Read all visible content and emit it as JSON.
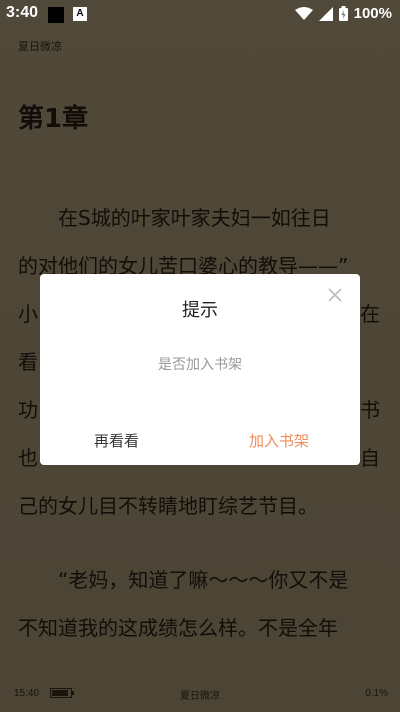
{
  "statusbar": {
    "time": "3:40",
    "notif_icon": "A",
    "battery": "100%"
  },
  "book_title": "夏日微凉",
  "chapter_title": "第1章",
  "paragraph_lines": [
    "　　在S城的叶家叶家夫妇一如往日",
    "的对他们的女儿苦口婆心的教导——”",
    "小",
    "看",
    "功",
    "也",
    "己的女儿目不转睛地盯综艺节目。",
    "　　“老妈，知道了嘛～～～你又不是",
    "不知道我的这成绩怎么样。不是全年"
  ],
  "peek_right": [
    "在",
    "书",
    "自"
  ],
  "footer": {
    "time": "15:40",
    "book": "夏日微凉",
    "progress": "0.1%"
  },
  "dialog": {
    "title": "提示",
    "message": "是否加入书架",
    "cancel": "再看看",
    "confirm": "加入书架"
  },
  "colors": {
    "accent": "#f08c5a",
    "page_bg": "#8a7c62"
  }
}
